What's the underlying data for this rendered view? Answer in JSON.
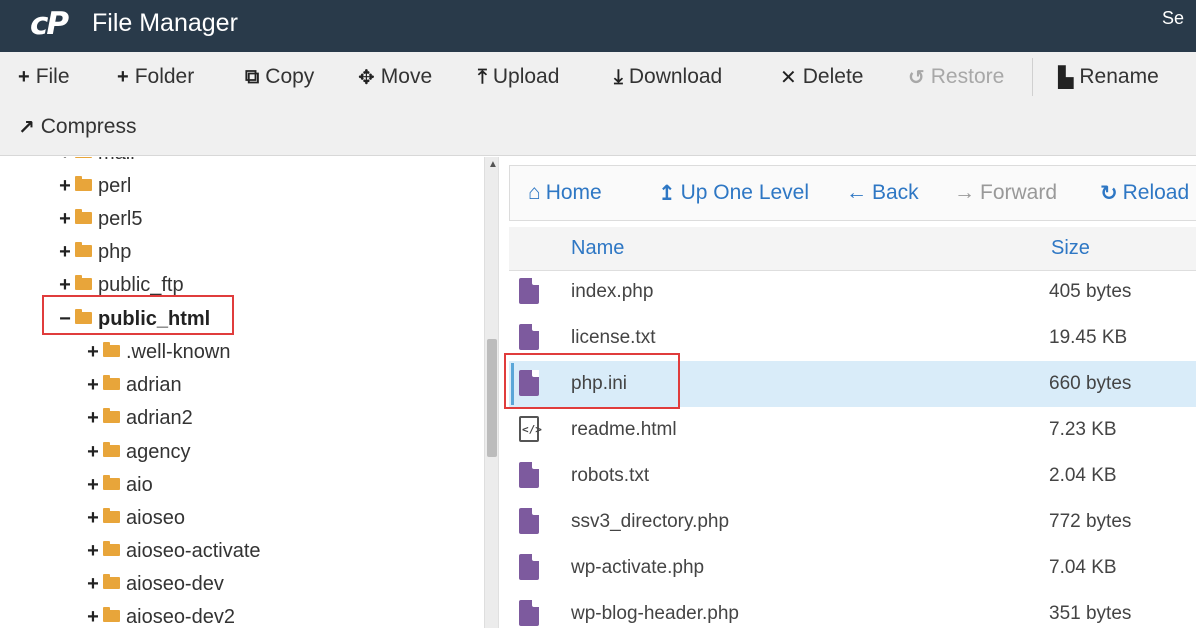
{
  "app": {
    "logo": "cP",
    "title": "File Manager",
    "search_stub": "Se"
  },
  "toolbar": {
    "file": "File",
    "folder": "Folder",
    "copy": "Copy",
    "move": "Move",
    "upload": "Upload",
    "download": "Download",
    "delete": "Delete",
    "restore": "Restore",
    "rename": "Rename",
    "compress": "Compress"
  },
  "tree": {
    "partial_top": "mail",
    "items": [
      {
        "toggle": "+",
        "label": "perl"
      },
      {
        "toggle": "+",
        "label": "perl5"
      },
      {
        "toggle": "+",
        "label": "php"
      },
      {
        "toggle": "+",
        "label": "public_ftp"
      },
      {
        "toggle": "−",
        "label": "public_html"
      },
      {
        "toggle": "+",
        "label": ".well-known"
      },
      {
        "toggle": "+",
        "label": "adrian"
      },
      {
        "toggle": "+",
        "label": "adrian2"
      },
      {
        "toggle": "+",
        "label": "agency"
      },
      {
        "toggle": "+",
        "label": "aio"
      },
      {
        "toggle": "+",
        "label": "aioseo"
      },
      {
        "toggle": "+",
        "label": "aioseo-activate"
      },
      {
        "toggle": "+",
        "label": "aioseo-dev"
      },
      {
        "toggle": "+",
        "label": "aioseo-dev2"
      }
    ]
  },
  "nav": {
    "home": "Home",
    "up": "Up One Level",
    "back": "Back",
    "forward": "Forward",
    "reload": "Reload"
  },
  "table": {
    "col_name": "Name",
    "col_size": "Size",
    "rows": [
      {
        "name": "index.php",
        "size": "405 bytes"
      },
      {
        "name": "license.txt",
        "size": "19.45 KB"
      },
      {
        "name": "php.ini",
        "size": "660 bytes"
      },
      {
        "name": "readme.html",
        "size": "7.23 KB"
      },
      {
        "name": "robots.txt",
        "size": "2.04 KB"
      },
      {
        "name": "ssv3_directory.php",
        "size": "772 bytes"
      },
      {
        "name": "wp-activate.php",
        "size": "7.04 KB"
      },
      {
        "name": "wp-blog-header.php",
        "size": "351 bytes"
      }
    ]
  },
  "colors": {
    "titlebar": "#293a4a",
    "link_blue": "#2e77c4",
    "folder": "#e8a53a",
    "file_icon": "#7d5a9e",
    "highlight_row": "#d9ecf9",
    "annotation_red": "#e03c3c"
  }
}
